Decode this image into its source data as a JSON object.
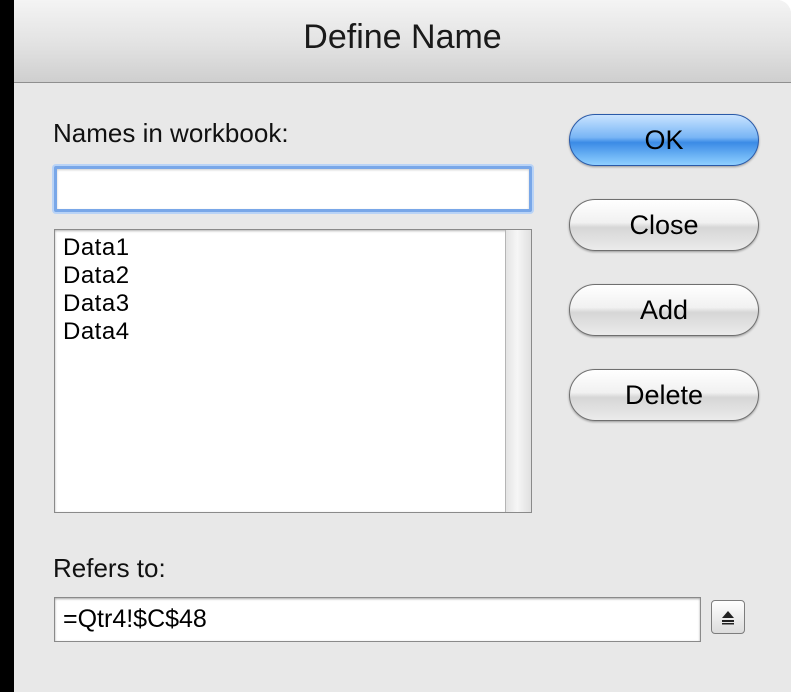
{
  "dialog": {
    "title": "Define Name"
  },
  "names_section": {
    "label": "Names in workbook:",
    "name_value": "",
    "items": [
      "Data1",
      "Data2",
      "Data3",
      "Data4"
    ]
  },
  "buttons": {
    "ok": "OK",
    "close": "Close",
    "add": "Add",
    "delete": "Delete"
  },
  "refers_section": {
    "label": "Refers to:",
    "value": "=Qtr4!$C$48"
  },
  "icons": {
    "collapse": "collapse-dialog-icon"
  },
  "colors": {
    "ok_accent": "#3b8be6",
    "focus_ring": "#79a7e8"
  }
}
